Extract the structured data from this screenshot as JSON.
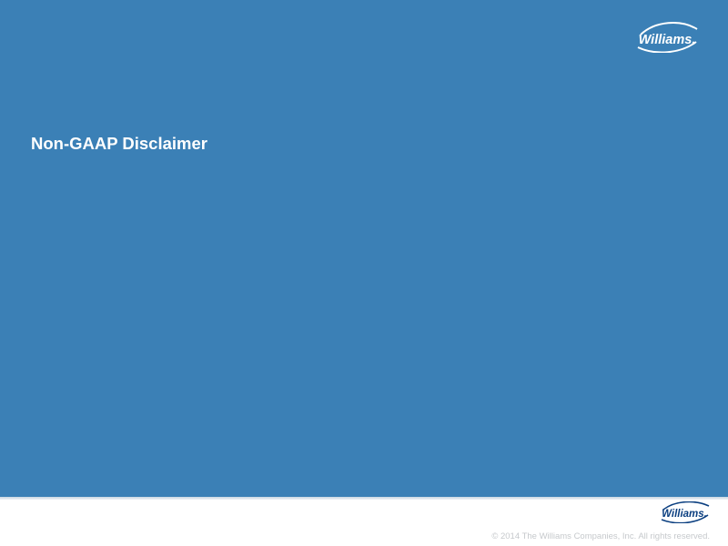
{
  "slide": {
    "title": "Non-GAAP Disclaimer",
    "background_color": "#3b80b6"
  },
  "branding": {
    "logo_text": "Williams.",
    "logo_color_on_blue": "#ffffff",
    "logo_color_on_white": "#0b3f80"
  },
  "footer": {
    "copyright": "© 2014 The Williams Companies, Inc. All rights reserved."
  }
}
